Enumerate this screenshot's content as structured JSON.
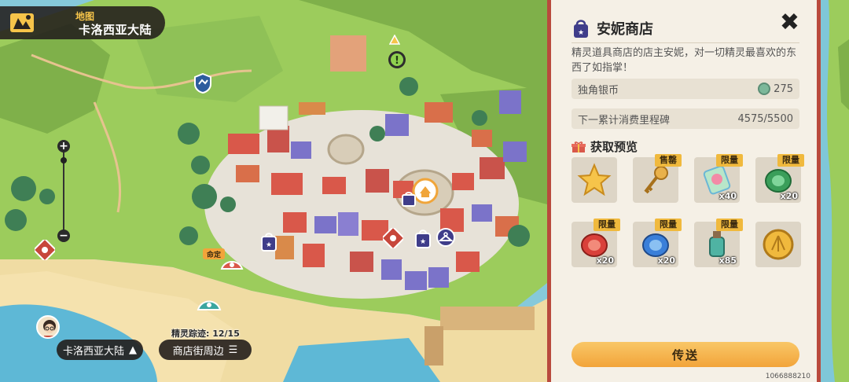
{
  "map": {
    "title_small": "地图",
    "title_big": "卡洛西亚大陆",
    "zoom_in": "+",
    "zoom_out": "−",
    "sprite_trace": "精灵踪迹: 12/15",
    "region_chip": "卡洛西亚大陆",
    "area_chip": "商店街周边",
    "pin_label": "命定",
    "quest_marker": "!"
  },
  "shop": {
    "title": "安妮商店",
    "close": "✖",
    "description": "精灵道具商店的店主安妮，对一切精灵最喜欢的东西了如指掌！",
    "currency_label": "独角银币",
    "currency_value": "275",
    "milestone_label": "下一累计消费里程碑",
    "milestone_value": "4575/5500",
    "preview_title": "获取预览",
    "items": [
      {
        "name": "star",
        "tag": "",
        "qty": ""
      },
      {
        "name": "key",
        "tag": "售罄",
        "qty": ""
      },
      {
        "name": "rainbow-crystal",
        "tag": "限量",
        "qty": "x40"
      },
      {
        "name": "green-gem",
        "tag": "限量",
        "qty": "x20"
      },
      {
        "name": "red-gem",
        "tag": "限量",
        "qty": "x20"
      },
      {
        "name": "blue-gem",
        "tag": "限量",
        "qty": "x20"
      },
      {
        "name": "teal-bottle",
        "tag": "限量",
        "qty": "x85"
      },
      {
        "name": "gold-shell-coin",
        "tag": "",
        "qty": ""
      }
    ],
    "teleport_label": "传送",
    "uid": "1066888210"
  },
  "colors": {
    "panel_border": "#b94a3d",
    "button_gold": "#f2a43a",
    "tag_gold": "#f0b93d"
  }
}
